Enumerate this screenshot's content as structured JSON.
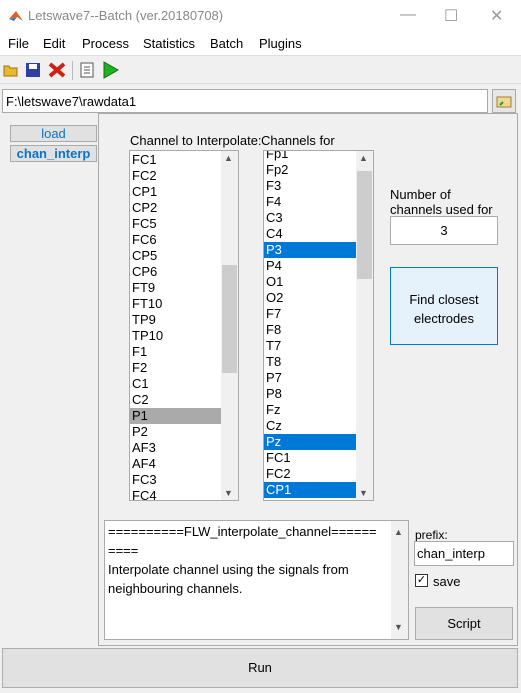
{
  "window": {
    "title": "Letswave7--Batch (ver.20180708)",
    "minimize": "—",
    "maximize": "☐",
    "close": "✕"
  },
  "menu": [
    "File",
    "Edit",
    "Process",
    "Statistics",
    "Batch",
    "Plugins"
  ],
  "toolbar": {
    "icons": [
      "open-folder-icon",
      "save-disk-icon",
      "delete-x-icon",
      "script-document-icon",
      "run-play-icon"
    ]
  },
  "path": {
    "value": "F:\\letswave7\\rawdata1"
  },
  "nav": [
    {
      "label": "load"
    },
    {
      "label": "chan_interp"
    }
  ],
  "panel": {
    "label_interpolate": "Channel to Interpolate:",
    "label_channels_for": "Channels for",
    "left_list": {
      "items": [
        "FC1",
        "FC2",
        "CP1",
        "CP2",
        "FC5",
        "FC6",
        "CP5",
        "CP6",
        "FT9",
        "FT10",
        "TP9",
        "TP10",
        "F1",
        "F2",
        "C1",
        "C2",
        "P1",
        "P2",
        "AF3",
        "AF4",
        "FC3",
        "FC4"
      ],
      "selected": "P1"
    },
    "right_list": {
      "items": [
        "Fp1",
        "Fp2",
        "F3",
        "F4",
        "C3",
        "C4",
        "P3",
        "P4",
        "O1",
        "O2",
        "F7",
        "F8",
        "T7",
        "T8",
        "P7",
        "P8",
        "Fz",
        "Cz",
        "Pz",
        "FC1",
        "FC2",
        "CP1"
      ],
      "selected": [
        "P3",
        "Pz",
        "CP1"
      ]
    },
    "number_label": "Number of channels used for",
    "number_value": "3",
    "find_button": "Find closest electrodes",
    "description": [
      "==========FLW_interpolate_channel======",
      "====",
      "Interpolate channel using the signals from",
      "neighbouring channels."
    ],
    "prefix_label": "prefix:",
    "prefix_value": "chan_interp",
    "save_label": "save",
    "save_checked": true,
    "script_button": "Script"
  },
  "run_button": "Run",
  "colors": {
    "selection": "#0078d7",
    "nav_text": "#0a74c9"
  }
}
